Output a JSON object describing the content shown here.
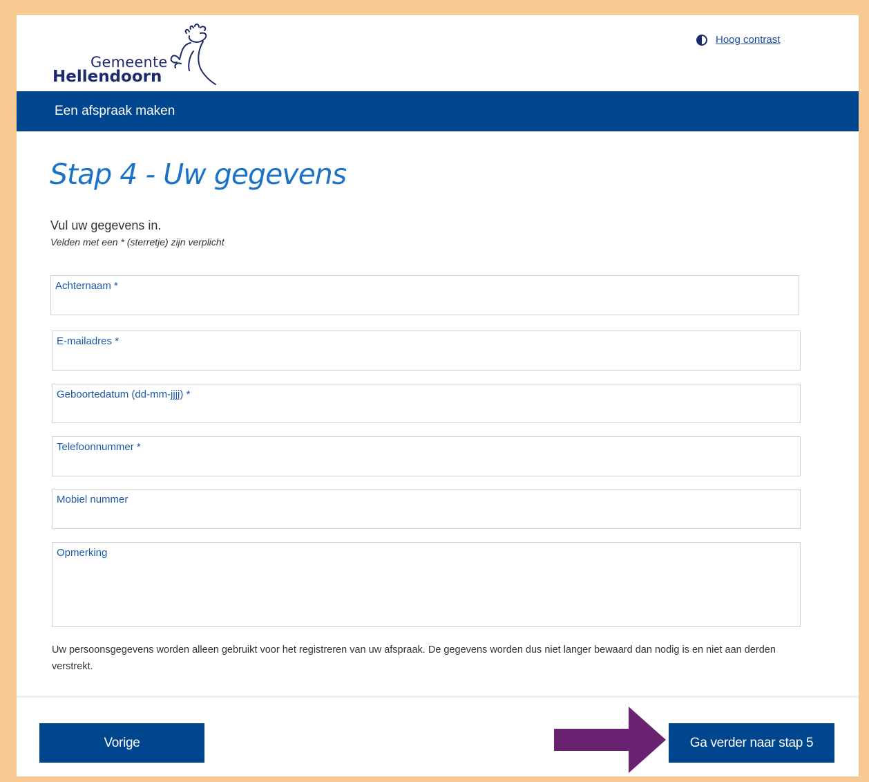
{
  "header": {
    "logo_line1": "Gemeente",
    "logo_line2": "Hellendoorn",
    "contrast_link": "Hoog contrast"
  },
  "bluebar": {
    "title": "Een afspraak maken"
  },
  "main": {
    "step_title": "Stap 4 - Uw gegevens",
    "intro": "Vul uw gegevens in.",
    "required_note": "Velden met een * (sterretje) zijn verplicht",
    "fields": [
      {
        "label": "Achternaam *",
        "value": ""
      },
      {
        "label": "E-mailadres *",
        "value": ""
      },
      {
        "label": "Geboortedatum (dd-mm-jjjj) *",
        "value": ""
      },
      {
        "label": "Telefoonnummer *",
        "value": ""
      },
      {
        "label": "Mobiel nummer",
        "value": ""
      },
      {
        "label": "Opmerking",
        "value": ""
      }
    ],
    "privacy_text": "Uw persoonsgegevens worden alleen gebruikt voor het registreren van uw afspraak. De gegevens worden dus niet langer bewaard dan nodig is en niet aan derden verstrekt."
  },
  "footer": {
    "prev_label": "Vorige",
    "next_label": "Ga verder naar stap 5"
  },
  "colors": {
    "brand_blue": "#00468f",
    "title_blue": "#1b72c6",
    "frame_orange": "#f7c993",
    "arrow_purple": "#6a2371"
  },
  "icons": {
    "contrast": "contrast-icon",
    "arrow": "arrow-right-icon",
    "logo": "tree-logo-icon"
  }
}
